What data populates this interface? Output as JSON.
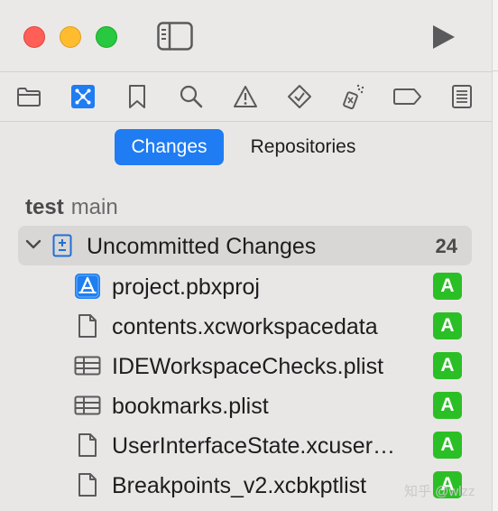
{
  "toolbar": {
    "window_controls": [
      "close",
      "minimize",
      "zoom"
    ],
    "sidebar_toggle_icon": "sidebar-left-icon",
    "run_icon": "play-icon"
  },
  "navigator": {
    "icons": [
      "folder-icon",
      "source-control-icon",
      "bookmark-icon",
      "search-icon",
      "warning-icon",
      "test-icon",
      "debug-icon",
      "breakpoint-icon",
      "report-icon"
    ],
    "selected": "source-control-icon"
  },
  "segments": {
    "changes": "Changes",
    "repositories": "Repositories",
    "selected": "Changes"
  },
  "repo": {
    "name": "test",
    "branch": "main"
  },
  "uncommitted": {
    "label": "Uncommitted Changes",
    "count": "24"
  },
  "files": [
    {
      "name": "project.pbxproj",
      "icon": "xcode-project-icon",
      "status": "A"
    },
    {
      "name": "contents.xcworkspacedata",
      "icon": "document-icon",
      "status": "A"
    },
    {
      "name": "IDEWorkspaceChecks.plist",
      "icon": "table-icon",
      "status": "A"
    },
    {
      "name": "bookmarks.plist",
      "icon": "table-icon",
      "status": "A"
    },
    {
      "name": "UserInterfaceState.xcuser…",
      "icon": "document-icon",
      "status": "A"
    },
    {
      "name": "Breakpoints_v2.xcbkptlist",
      "icon": "document-icon",
      "status": "A"
    }
  ],
  "watermark": "知乎 @wlzz",
  "colors": {
    "accent": "#1f7cf2",
    "added_badge": "#2bbf26",
    "close": "#ff5f57",
    "minimize": "#febc2e",
    "zoom": "#28c840"
  }
}
